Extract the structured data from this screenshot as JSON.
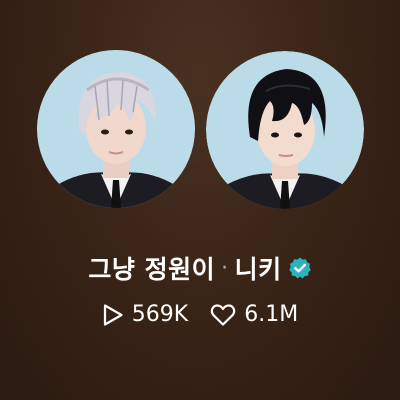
{
  "profile": {
    "name_primary": "그냥 정원이",
    "separator": "·",
    "name_secondary": "니키",
    "verified_icon": "verified-badge-icon",
    "verified_color": "#2bb3c0"
  },
  "stats": {
    "plays_icon": "play-icon",
    "plays": "569K",
    "likes_icon": "heart-icon",
    "likes": "6.1M"
  },
  "avatars": [
    {
      "icon": "avatar-photo-silver-hair",
      "bg": "#b9d8e6"
    },
    {
      "icon": "avatar-photo-black-hair",
      "bg": "#b9d8e6"
    }
  ]
}
